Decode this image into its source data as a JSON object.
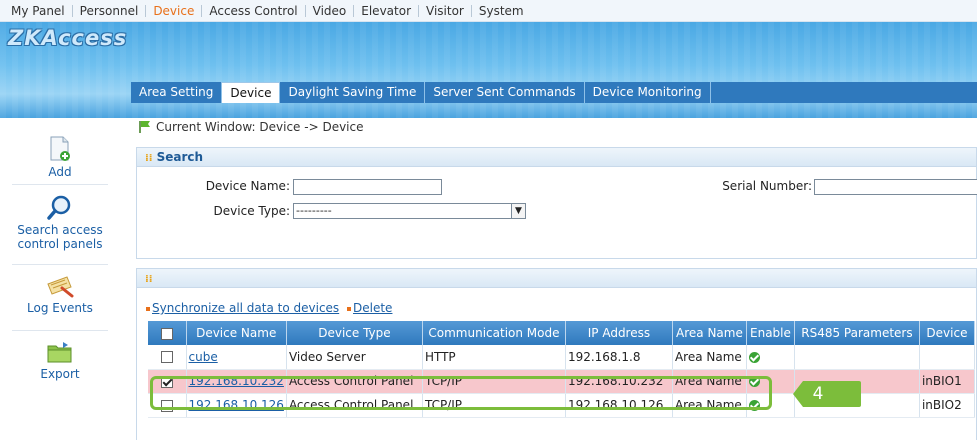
{
  "top_menu": [
    "My Panel",
    "Personnel",
    "Device",
    "Access Control",
    "Video",
    "Elevator",
    "Visitor",
    "System"
  ],
  "active_menu": "Device",
  "logo_text": "ZKAccess",
  "tabs": [
    "Area Setting",
    "Device",
    "Daylight Saving Time",
    "Server Sent Commands",
    "Device Monitoring"
  ],
  "active_tab": "Device",
  "sidebar": {
    "add": "Add",
    "search_line1": "Search access",
    "search_line2": "control panels",
    "log_events": "Log Events",
    "export": "Export"
  },
  "breadcrumb": "Current Window: Device -> Device",
  "search": {
    "title": "Search",
    "device_name_label": "Device Name:",
    "device_name_value": "",
    "serial_number_label": "Serial Number:",
    "serial_number_value": "",
    "device_type_label": "Device Type:",
    "device_type_value": "---------"
  },
  "list_panel_title": "",
  "actions": {
    "sync": "Synchronize all data to devices",
    "delete": "Delete"
  },
  "table": {
    "columns": [
      "Device Name",
      "Device Type",
      "Communication Mode",
      "IP Address",
      "Area Name",
      "Enable",
      "RS485 Parameters",
      "Device"
    ],
    "rows": [
      {
        "checked": false,
        "name": "cube",
        "type": "Video Server",
        "comm": "HTTP",
        "ip": "192.168.1.8",
        "area": "Area Name",
        "enable": true,
        "rs485": "",
        "device": ""
      },
      {
        "checked": true,
        "name": "192.168.10.232",
        "type": "Access Control Panel",
        "comm": "TCP/IP",
        "ip": "192.168.10.232",
        "area": "Area Name",
        "enable": true,
        "rs485": "",
        "device": "inBIO1"
      },
      {
        "checked": false,
        "name": "192.168.10.126",
        "type": "Access Control Panel",
        "comm": "TCP/IP",
        "ip": "192.168.10.126",
        "area": "Area Name",
        "enable": true,
        "rs485": "",
        "device": "inBIO2"
      }
    ]
  },
  "callout_label": "4",
  "colors": {
    "accent": "#2f79bd",
    "active_menu": "#e8701a",
    "selected_row": "#f7c7cc",
    "callout": "#7cbd3b"
  }
}
